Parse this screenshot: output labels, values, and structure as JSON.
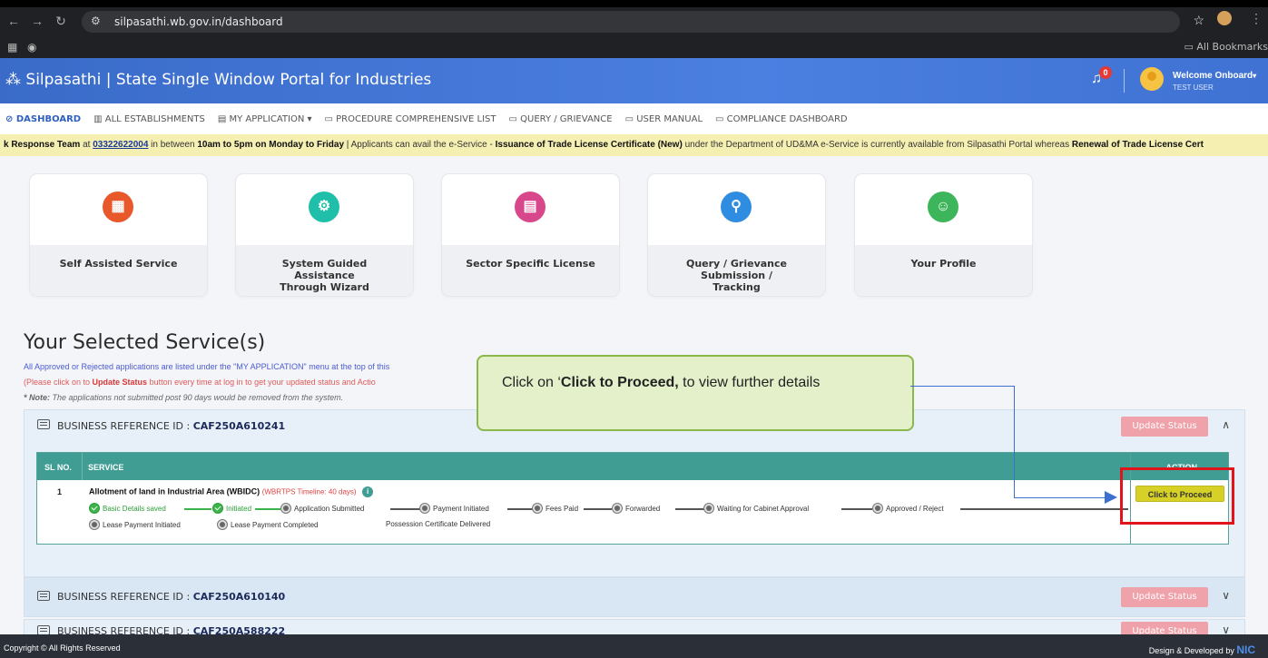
{
  "browser": {
    "url": "silpasathi.wb.gov.in/dashboard",
    "all_bookmarks": "All Bookmarks"
  },
  "header": {
    "title": "Silpasathi | State Single Window Portal for Industries",
    "notification_count": "0",
    "welcome": "Welcome Onboard",
    "user": "TEST USER"
  },
  "menu": {
    "dashboard": "DASHBOARD",
    "establishments": "ALL ESTABLISHMENTS",
    "my_application": "MY APPLICATION",
    "procedure": "PROCEDURE COMPREHENSIVE LIST",
    "query": "QUERY / GRIEVANCE",
    "manual": "USER MANUAL",
    "compliance": "COMPLIANCE DASHBOARD"
  },
  "ticker": {
    "p1": "k Response Team",
    "p2": " at ",
    "phone": "03322622004",
    "p3": " in between ",
    "time": "10am to 5pm on Monday to Friday",
    "p4": "   |   Applicants can avail the e-Service - ",
    "service": "Issuance of Trade License Certificate (New)",
    "p5": " under the Department of UD&MA e-Service is currently available from Silpasathi Portal whereas ",
    "renewal": "Renewal of Trade License Cert"
  },
  "cards": [
    {
      "label": "Self Assisted Service",
      "color": "#e8582a",
      "icon": "grid-icon"
    },
    {
      "label": "System Guided Assistance Through Wizard",
      "color": "#1fbfa9",
      "icon": "gear-icon"
    },
    {
      "label": "Sector Specific License",
      "color": "#d8468c",
      "icon": "license-icon"
    },
    {
      "label": "Query / Grievance Submission / Tracking",
      "color": "#2e8de0",
      "icon": "search-icon"
    },
    {
      "label": "Your Profile",
      "color": "#3db55a",
      "icon": "profile-icon"
    }
  ],
  "selected": {
    "title": "Your Selected Service(s)",
    "note1": "All Approved or Rejected applications are listed under the \"MY APPLICATION\" menu at the top of this",
    "note2_a": "(Please click on to ",
    "note2_b": "Update Status",
    "note2_c": " button every time at log in to get your updated status and Actio",
    "note3_a": "* Note:",
    "note3_b": " The applications not submitted post 90 days would be removed from the system."
  },
  "business": {
    "label": "BUSINESS REFERENCE ID :",
    "update": "Update Status",
    "items": [
      {
        "id": "CAF250A610241"
      },
      {
        "id": "CAF250A610140"
      },
      {
        "id": "CAF250A588222"
      }
    ]
  },
  "service_table": {
    "headers": [
      "SL NO.",
      "SERVICE",
      "ACTION"
    ],
    "row": {
      "sl": "1",
      "name": "Allotment of land in Industrial Area (WBIDC)",
      "timeline": "(WBRTPS Timeline: 40 days)",
      "action": "Click to Proceed"
    },
    "steps": [
      {
        "label": "Basic Details saved",
        "done": true
      },
      {
        "label": "Initiated",
        "done": true
      },
      {
        "label": "Application Submitted",
        "done": false
      },
      {
        "label": "Payment Initiated",
        "done": false
      },
      {
        "label": "Fees Paid",
        "done": false
      },
      {
        "label": "Forwarded",
        "done": false
      },
      {
        "label": "Waiting for Cabinet Approval",
        "done": false
      },
      {
        "label": "Approved / Reject",
        "done": false
      },
      {
        "label": "Lease Payment Initiated",
        "done": false
      },
      {
        "label": "Lease Payment Completed",
        "done": false
      },
      {
        "label": "Possession Certificate Delivered",
        "done": false
      }
    ]
  },
  "callout": {
    "a": "Click on ‘",
    "b": "Click to Proceed,",
    "c": " to view further details"
  },
  "footer": {
    "left": "Copyright © All Rights Reserved",
    "right": "Design & Developed by ",
    "nic": "NIC"
  },
  "colors": {
    "header_blue": "#3a6bc9",
    "teal": "#3f9d94",
    "update_pink": "#f0a2ab",
    "proceed_yellow": "#d7d026",
    "highlight_red": "#e0141a"
  }
}
